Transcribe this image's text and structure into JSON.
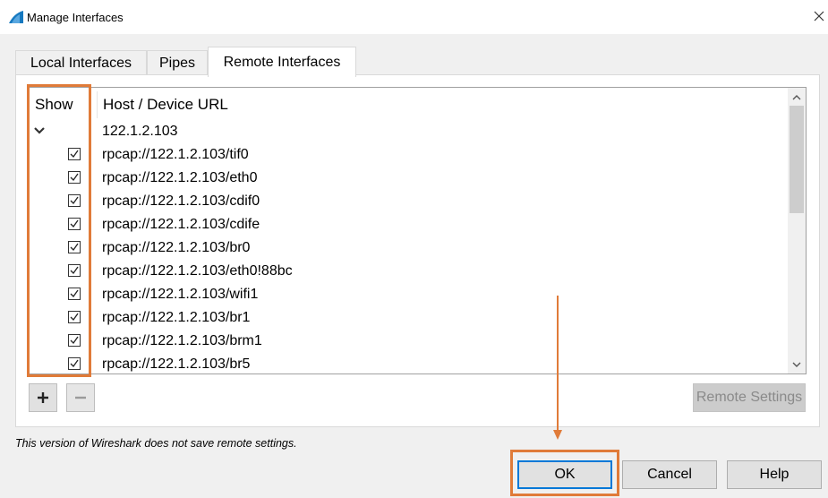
{
  "window": {
    "title": "Manage Interfaces",
    "icon": "wireshark-fin-icon",
    "close_icon": "close-icon"
  },
  "tabs": [
    {
      "label": "Local Interfaces",
      "active": false
    },
    {
      "label": "Pipes",
      "active": false
    },
    {
      "label": "Remote Interfaces",
      "active": true
    }
  ],
  "table": {
    "columns": [
      "Show",
      "Host / Device URL"
    ],
    "group": {
      "host": "122.1.2.103",
      "expanded": true
    },
    "rows": [
      {
        "url": "rpcap://122.1.2.103/tif0",
        "checked": true
      },
      {
        "url": "rpcap://122.1.2.103/eth0",
        "checked": true
      },
      {
        "url": "rpcap://122.1.2.103/cdif0",
        "checked": true
      },
      {
        "url": "rpcap://122.1.2.103/cdife",
        "checked": true
      },
      {
        "url": "rpcap://122.1.2.103/br0",
        "checked": true
      },
      {
        "url": "rpcap://122.1.2.103/eth0!88bc",
        "checked": true
      },
      {
        "url": "rpcap://122.1.2.103/wifi1",
        "checked": true
      },
      {
        "url": "rpcap://122.1.2.103/br1",
        "checked": true
      },
      {
        "url": "rpcap://122.1.2.103/brm1",
        "checked": true
      },
      {
        "url": "rpcap://122.1.2.103/br5",
        "checked": true
      }
    ]
  },
  "toolbar": {
    "add_label": "+",
    "remove_label": "−",
    "remote_settings_label": "Remote Settings"
  },
  "notice": "This version of Wireshark does not save remote settings.",
  "buttons": {
    "ok": "OK",
    "cancel": "Cancel",
    "help": "Help"
  },
  "colors": {
    "highlight": "#e07b39",
    "focus": "#0078d7",
    "wireshark_blue": "#1679c0"
  }
}
